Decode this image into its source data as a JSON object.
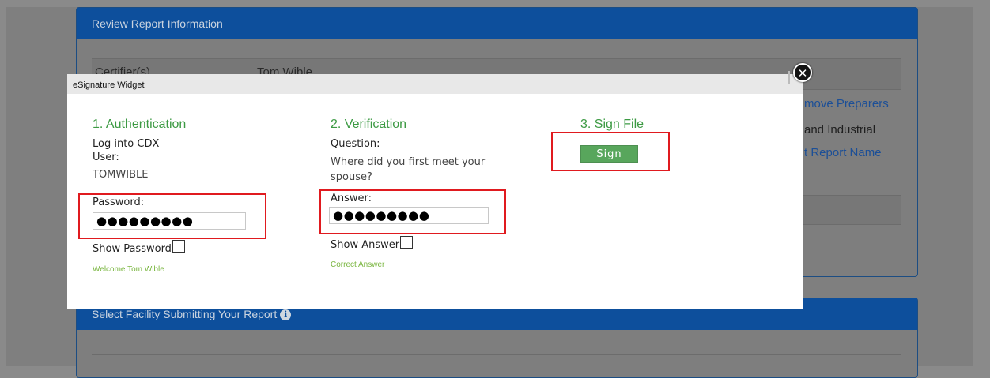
{
  "background": {
    "review_panel_title": "Review Report Information",
    "certifier_label": "Certifier(s)",
    "certifier_value": "Tom Wible",
    "remove_preparers": "move Preparers",
    "industrial_text": "and Industrial",
    "report_name_link": "t Report Name",
    "facility_panel_title": "Select Facility Submitting Your Report",
    "info_icon": "info-icon"
  },
  "modal": {
    "title": "eSignature Widget",
    "close_glyph": "✕",
    "authentication": {
      "title": "1. Authentication",
      "login_text": "Log into CDX",
      "user_label": "User:",
      "user_value": "TOMWIBLE",
      "password_label": "Password:",
      "password_value": "●●●●●●●●●",
      "show_password_label": "Show Password",
      "status": "Welcome Tom Wible"
    },
    "verification": {
      "title": "2. Verification",
      "question_label": "Question:",
      "question_text": "Where did you first meet your spouse?",
      "answer_label": "Answer:",
      "answer_value": "●●●●●●●●●",
      "show_answer_label": "Show Answer",
      "status": "Correct Answer"
    },
    "sign": {
      "title": "3. Sign File",
      "button_label": "Sign"
    }
  },
  "colors": {
    "step_title": "#3c9a43",
    "highlight": "#e01a1f",
    "sign_button": "#58a65c",
    "header_bg": "#0d4f9c"
  }
}
